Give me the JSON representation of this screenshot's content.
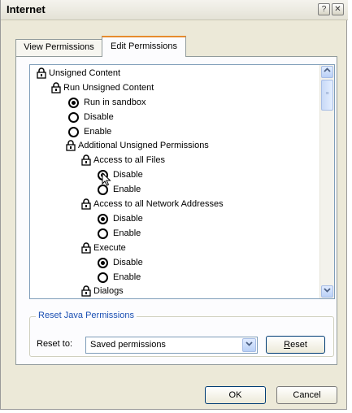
{
  "window": {
    "title": "Internet",
    "help_glyph": "?",
    "close_glyph": "✕"
  },
  "tabs": [
    {
      "label": "View Permissions",
      "active": false
    },
    {
      "label": "Edit Permissions",
      "active": true
    }
  ],
  "tree": {
    "items": [
      {
        "label": "Unsigned Content",
        "kind": "lock"
      },
      {
        "label": "Run Unsigned Content",
        "kind": "lock"
      },
      {
        "label": "Run in sandbox",
        "kind": "radio",
        "selected": true
      },
      {
        "label": "Disable",
        "kind": "radio",
        "selected": false
      },
      {
        "label": "Enable",
        "kind": "radio",
        "selected": false
      },
      {
        "label": "Additional Unsigned Permissions",
        "kind": "lock"
      },
      {
        "label": "Access to all Files",
        "kind": "lock"
      },
      {
        "label": "Disable",
        "kind": "radio",
        "selected": true
      },
      {
        "label": "Enable",
        "kind": "radio",
        "selected": false
      },
      {
        "label": "Access to all Network Addresses",
        "kind": "lock"
      },
      {
        "label": "Disable",
        "kind": "radio",
        "selected": true
      },
      {
        "label": "Enable",
        "kind": "radio",
        "selected": false
      },
      {
        "label": "Execute",
        "kind": "lock"
      },
      {
        "label": "Disable",
        "kind": "radio",
        "selected": true
      },
      {
        "label": "Enable",
        "kind": "radio",
        "selected": false
      },
      {
        "label": "Dialogs",
        "kind": "lock"
      }
    ]
  },
  "reset_group": {
    "legend": "Reset Java Permissions",
    "reset_to_label": "Reset to:",
    "selected_option": "Saved permissions",
    "reset_button": {
      "before": "",
      "mnemonic": "R",
      "after": "eset"
    }
  },
  "footer": {
    "ok_label": "OK",
    "cancel_label": "Cancel"
  },
  "colors": {
    "dialog_bg": "#ece9d8",
    "tab_accent": "#e68b2c",
    "legend_text": "#1a4fb3",
    "border_blue": "#7f9db9"
  }
}
